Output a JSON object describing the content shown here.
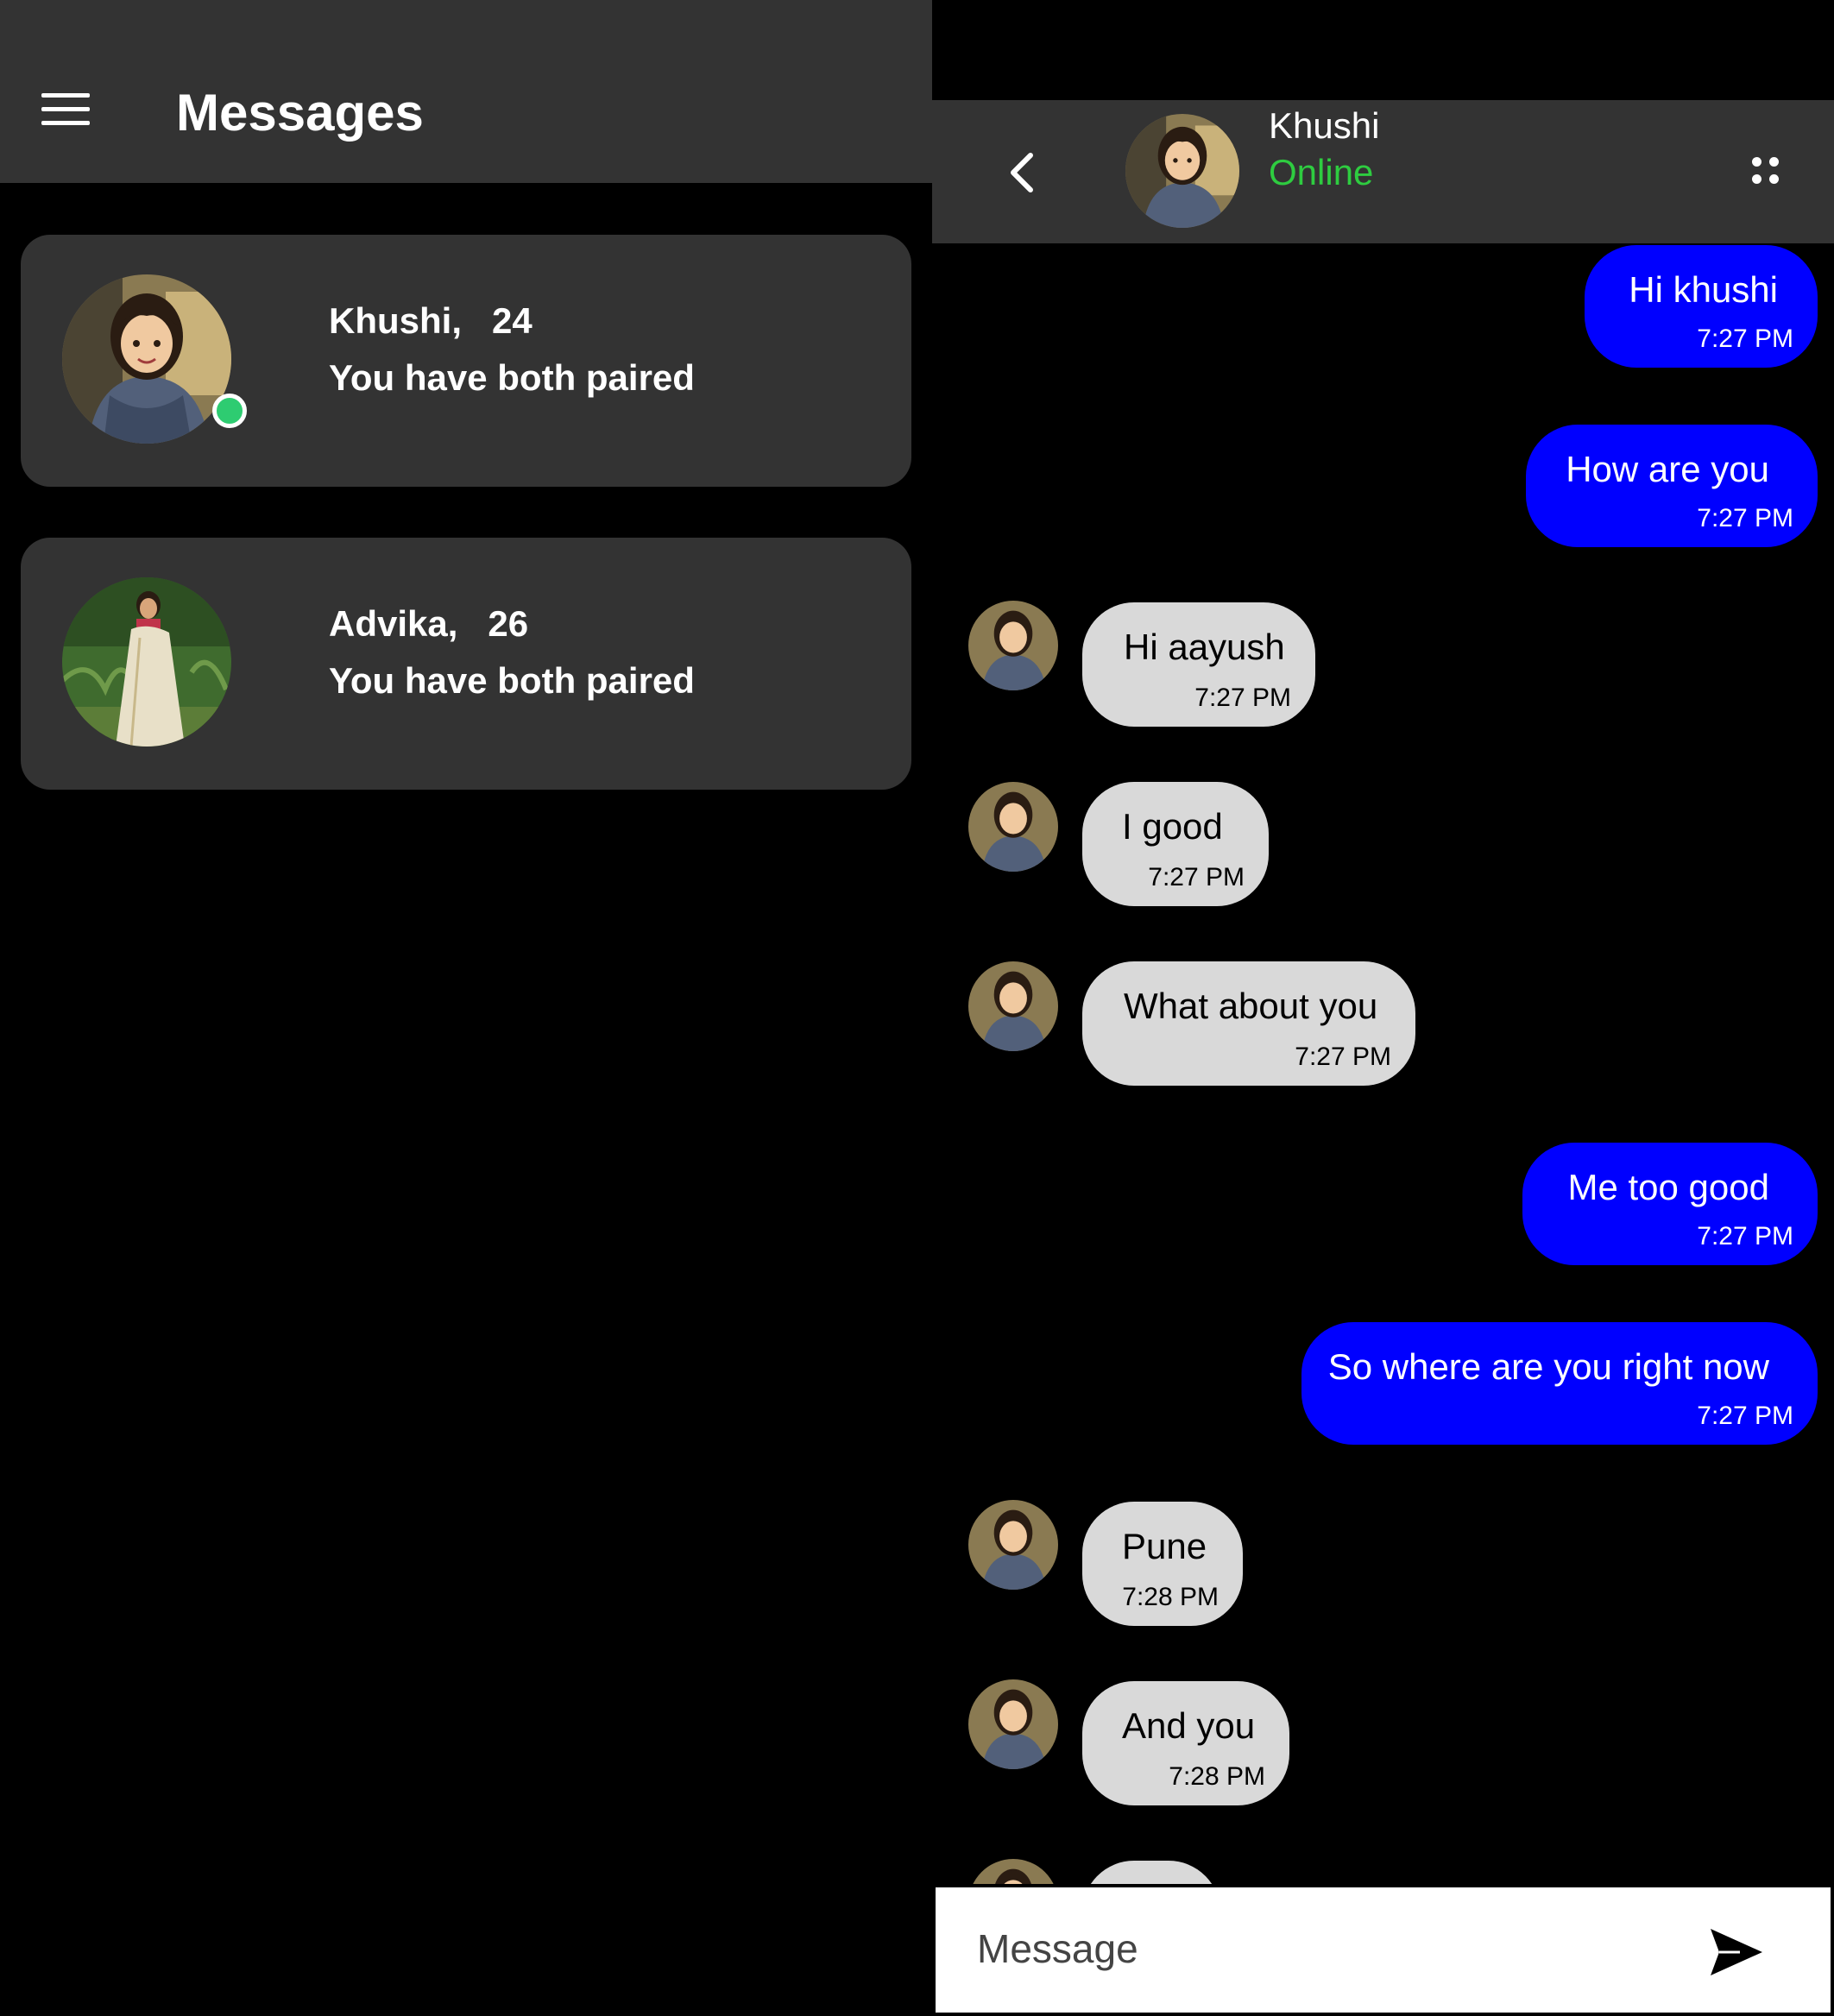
{
  "left": {
    "title": "Messages",
    "matches": [
      {
        "name": "Khushi,",
        "age": "24",
        "subtitle": "You have both paired",
        "online": true
      },
      {
        "name": "Advika,",
        "age": "26",
        "subtitle": "You have both paired",
        "online": false
      }
    ]
  },
  "chat": {
    "contact_name": "Khushi",
    "contact_status": "Online",
    "messages": [
      {
        "dir": "sent",
        "text": "Hi khushi",
        "time": "7:27 PM"
      },
      {
        "dir": "sent",
        "text": "How are you",
        "time": "7:27 PM"
      },
      {
        "dir": "recv",
        "text": "Hi aayush",
        "time": "7:27 PM"
      },
      {
        "dir": "recv",
        "text": "I good",
        "time": "7:27 PM"
      },
      {
        "dir": "recv",
        "text": "What about you",
        "time": "7:27 PM"
      },
      {
        "dir": "sent",
        "text": "Me too good",
        "time": "7:27 PM"
      },
      {
        "dir": "sent",
        "text": "So where are you right now",
        "time": "7:27 PM"
      },
      {
        "dir": "recv",
        "text": "Pune",
        "time": "7:28 PM"
      },
      {
        "dir": "recv",
        "text": "And you",
        "time": "7:28 PM"
      }
    ],
    "input_placeholder": "Message"
  },
  "colors": {
    "panel": "#333333",
    "sent_bubble": "#0000ff",
    "recv_bubble": "#d9d9d9",
    "online_green": "#2ecc40"
  },
  "icons": {
    "menu": "hamburger-icon",
    "back": "chevron-left-icon",
    "more": "four-dots-icon",
    "send": "send-icon"
  }
}
